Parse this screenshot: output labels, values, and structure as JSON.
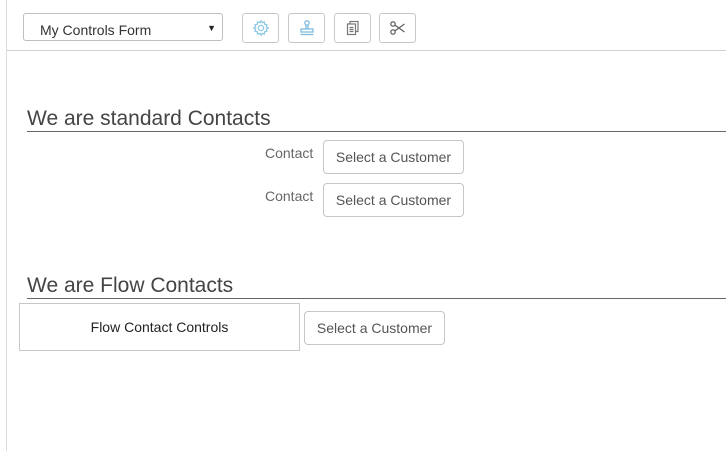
{
  "toolbar": {
    "form_select": {
      "value": "My Controls Form",
      "caret": "▼"
    },
    "buttons": [
      {
        "icon": "gear-icon",
        "color": "#8cc7e6"
      },
      {
        "icon": "stamp-icon",
        "color": "#7fbde0"
      },
      {
        "icon": "copy-icon",
        "color": "#777777"
      },
      {
        "icon": "scissors-icon",
        "color": "#666666"
      }
    ]
  },
  "standard_section": {
    "heading": "We are standard Contacts",
    "fields": [
      {
        "label": "Contact",
        "button": "Select a Customer"
      },
      {
        "label": "Contact",
        "button": "Select a Customer"
      }
    ]
  },
  "flow_section": {
    "heading": "We are Flow Contacts",
    "box_label": "Flow Contact Controls",
    "button": "Select a Customer"
  }
}
